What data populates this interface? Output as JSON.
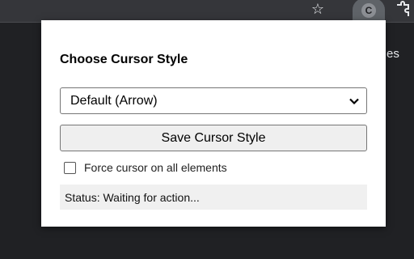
{
  "browser": {
    "star_icon": "☆",
    "extension_icon_letter": "C",
    "background_text": "es"
  },
  "popup": {
    "title": "Choose Cursor Style",
    "cursor_select": {
      "selected": "Default (Arrow)"
    },
    "save_button_label": "Save Cursor Style",
    "force_cursor": {
      "label": "Force cursor on all elements",
      "checked": false
    },
    "status": "Status: Waiting for action..."
  }
}
